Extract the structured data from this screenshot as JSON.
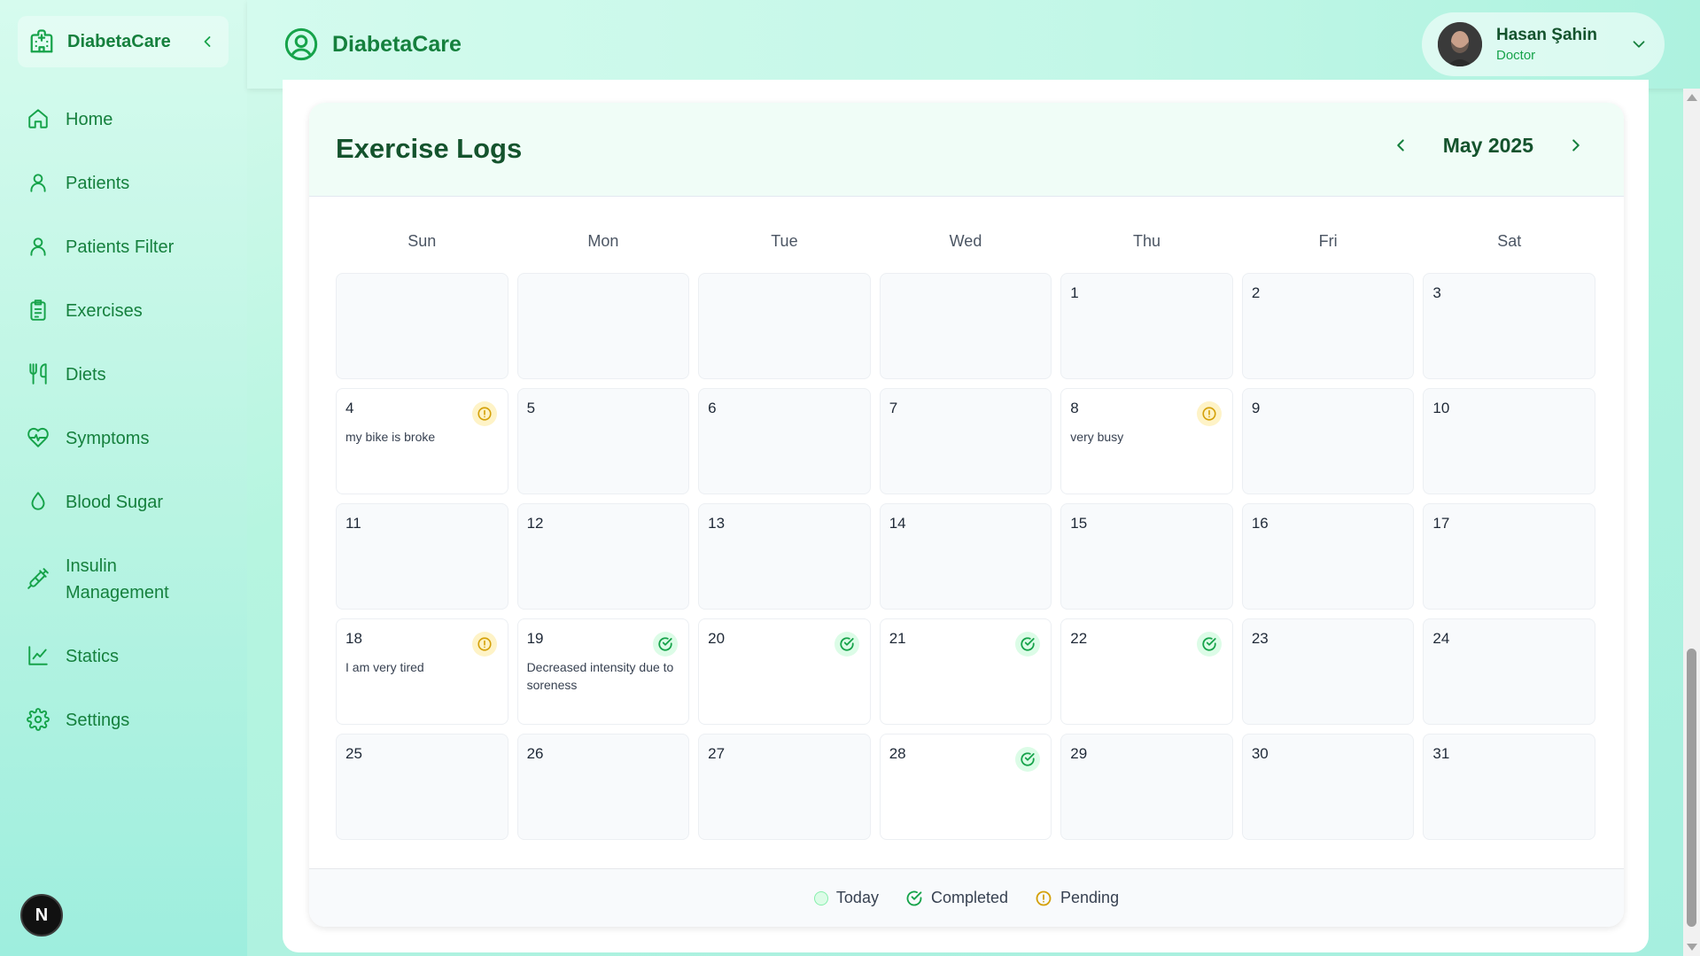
{
  "sidebar": {
    "brand": "DiabetaCare",
    "items": [
      {
        "label": "Home",
        "icon": "home-icon"
      },
      {
        "label": "Patients",
        "icon": "user-icon"
      },
      {
        "label": "Patients Filter",
        "icon": "user-icon"
      },
      {
        "label": "Exercises",
        "icon": "clipboard-icon"
      },
      {
        "label": "Diets",
        "icon": "utensils-icon"
      },
      {
        "label": "Symptoms",
        "icon": "heart-pulse-icon"
      },
      {
        "label": "Blood Sugar",
        "icon": "droplet-icon"
      },
      {
        "label": "Insulin Management",
        "icon": "syringe-icon"
      },
      {
        "label": "Statics",
        "icon": "line-chart-icon"
      },
      {
        "label": "Settings",
        "icon": "gear-icon"
      }
    ],
    "badge": "N"
  },
  "header": {
    "title": "DiabetaCare",
    "user": {
      "name": "Hasan Şahin",
      "role": "Doctor"
    }
  },
  "calendar": {
    "title": "Exercise Logs",
    "month": "May 2025",
    "weekdays": [
      "Sun",
      "Mon",
      "Tue",
      "Wed",
      "Thu",
      "Fri",
      "Sat"
    ],
    "leading_empty": 4,
    "days_in_month": 31,
    "logs": {
      "4": {
        "status": "pending",
        "note": "my bike is broke"
      },
      "8": {
        "status": "pending",
        "note": "very busy"
      },
      "18": {
        "status": "pending",
        "note": "I am very tired"
      },
      "19": {
        "status": "completed",
        "note": "Decreased intensity due to soreness"
      },
      "20": {
        "status": "completed",
        "note": ""
      },
      "21": {
        "status": "completed",
        "note": ""
      },
      "22": {
        "status": "completed",
        "note": ""
      },
      "28": {
        "status": "completed",
        "note": ""
      }
    },
    "legend": {
      "today": "Today",
      "completed": "Completed",
      "pending": "Pending"
    }
  },
  "colors": {
    "accent": "#16a34a",
    "pending": "#d4a10a",
    "completed": "#16a34a"
  }
}
